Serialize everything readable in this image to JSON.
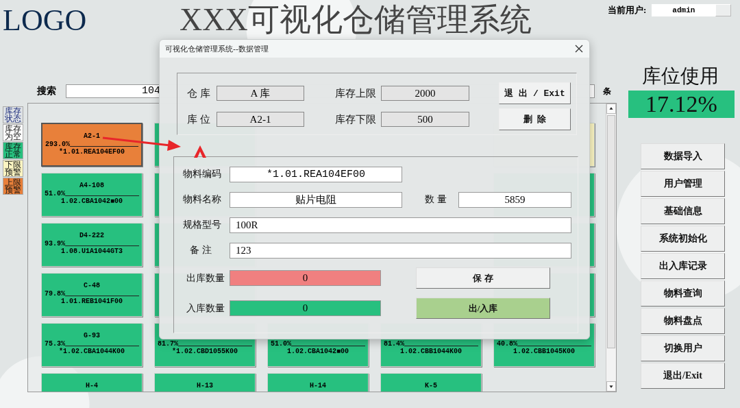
{
  "header": {
    "logo": "LOGO",
    "title": "XXX可视化仓储管理系统",
    "user_label": "当前用户:",
    "user": "admin"
  },
  "search": {
    "label": "搜索",
    "value": "104",
    "unit": "条"
  },
  "legend": [
    {
      "label": "库存状态",
      "color": "#dfe3e6"
    },
    {
      "label": "库存为空",
      "color": "#ffffff"
    },
    {
      "label": "库存正常",
      "color": "#27c07f"
    },
    {
      "label": "下限预警",
      "color": "#fbf5c2"
    },
    {
      "label": "上限预警",
      "color": "#e8803a"
    }
  ],
  "slot_rows": [
    [
      {
        "color": "#e8803a",
        "selected": true,
        "label": "A2-1",
        "percent": "293.0%",
        "code": "*1.01.REA104EF00"
      },
      {
        "color": "#27c07f",
        "selected": false
      },
      null,
      null,
      {
        "color": "#fbf5c2",
        "selected": false
      }
    ],
    [
      {
        "color": "#27c07f",
        "selected": false,
        "label": "A4-108",
        "percent": "51.0%",
        "code": "1.02.CBA1042■00"
      },
      {
        "color": "#27c07f",
        "selected": false
      },
      null,
      null,
      {
        "color": "#27c07f",
        "selected": false
      }
    ],
    [
      {
        "color": "#27c07f",
        "selected": false,
        "label": "D4-222",
        "percent": "93.9%",
        "code": "1.08.U1A1044GT3"
      },
      {
        "color": "#27c07f",
        "selected": false
      },
      null,
      null,
      {
        "color": "#27c07f",
        "selected": false
      }
    ],
    [
      {
        "color": "#27c07f",
        "selected": false,
        "label": "C-48",
        "percent": "79.8%",
        "code": "1.01.REB1041F00"
      },
      {
        "color": "#27c07f",
        "selected": false
      },
      null,
      null,
      {
        "color": "#27c07f",
        "selected": false
      }
    ],
    [
      {
        "color": "#27c07f",
        "selected": false,
        "label": "G-93",
        "percent": "75.3%",
        "code": "*1.02.CBA1044K00"
      },
      {
        "color": "#27c07f",
        "selected": false,
        "percent": "81.7%",
        "code": "*1.02.CBD1055K00"
      },
      {
        "color": "#27c07f",
        "selected": false,
        "percent": "51.0%",
        "code": "1.02.CBA1042■00"
      },
      {
        "color": "#27c07f",
        "selected": false,
        "percent": "81.4%",
        "code": "1.02.CBB1044K00"
      },
      {
        "color": "#27c07f",
        "selected": false,
        "percent": "40.8%",
        "code": "1.02.CBB1045K00"
      }
    ],
    [
      {
        "color": "#27c07f",
        "selected": false,
        "label": "H-4"
      },
      {
        "color": "#27c07f",
        "selected": false,
        "label": "H-13"
      },
      {
        "color": "#27c07f",
        "selected": false,
        "label": "H-14"
      },
      {
        "color": "#27c07f",
        "selected": false,
        "label": "K-5"
      },
      null
    ]
  ],
  "usage": {
    "title": "库位使用",
    "value": "17.12%"
  },
  "menu": [
    "数据导入",
    "用户管理",
    "基础信息",
    "系统初始化",
    "出入库记录",
    "物料查询",
    "物料盘点",
    "切换用户",
    "退出/Exit"
  ],
  "dialog": {
    "title": "可视化仓储管理系统--数据管理",
    "location": [
      {
        "label": "仓 库",
        "value": "A 库"
      },
      {
        "label": "库存上限",
        "value": "2000"
      },
      {
        "label": "库 位",
        "value": "A2-1"
      },
      {
        "label": "库存下限",
        "value": "500"
      }
    ],
    "buttons": [
      "退 出 / Exit",
      "删 除"
    ],
    "code": {
      "label": "物料编码",
      "value": "*1.01.REA104EF00"
    },
    "name": {
      "label": "物料名称",
      "value": "贴片电阻"
    },
    "qty": {
      "label": "数 量",
      "value": "5859"
    },
    "spec": {
      "label": "规格型号",
      "value": "100R"
    },
    "note": {
      "label": "备 注",
      "value": "123"
    },
    "stock_out": {
      "label": "出库数量",
      "value": "0"
    },
    "stock_in": {
      "label": "入库数量",
      "value": "0"
    },
    "save": "保 存",
    "transfer": "出/入库"
  }
}
